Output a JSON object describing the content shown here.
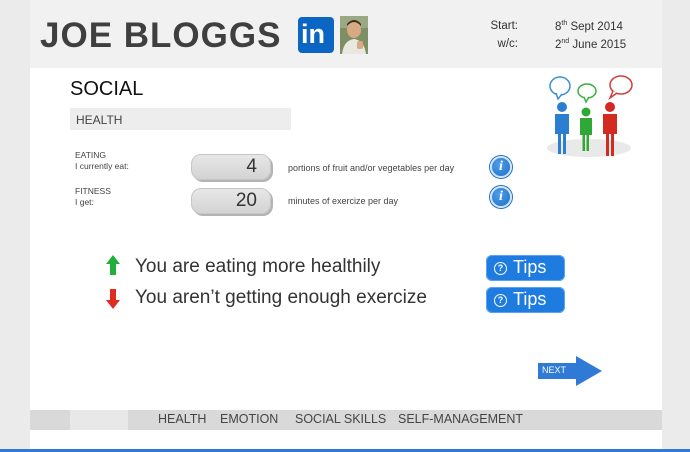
{
  "header": {
    "name": "JOE BLOGGS",
    "linkedin_label": "in",
    "start_label": "Start:",
    "start_day": "8",
    "start_day_suffix": "th",
    "start_rest": " Sept 2014",
    "wc_label": "w/c:",
    "wc_day": "2",
    "wc_day_suffix": "nd",
    "wc_rest": " June 2015"
  },
  "section": {
    "title": "SOCIAL",
    "subheading": "HEALTH"
  },
  "rows": [
    {
      "label_top": "EATING",
      "label_bottom": "I currently eat:",
      "value": "4",
      "note": "portions of fruit and/or vegetables per day"
    },
    {
      "label_top": "FITNESS",
      "label_bottom": "I get:",
      "value": "20",
      "note": "minutes of exercize per day"
    }
  ],
  "info_glyph": "i",
  "feedback": [
    {
      "text": "You are eating more healthily",
      "direction": "up",
      "color": "#22b03a",
      "tips_label": "Tips"
    },
    {
      "text": "You aren’t getting enough exercize",
      "direction": "down",
      "color": "#e02b20",
      "tips_label": "Tips"
    }
  ],
  "tips_glyph": "?",
  "next_label": "NEXT",
  "nav": {
    "tabs": [
      "HEALTH",
      "EMOTION",
      "SOCIAL SKILLS",
      "SELF-MANAGEMENT"
    ]
  },
  "colors": {
    "accent": "#1e7be0",
    "linkedin": "#0a66c2",
    "header_bg": "#f1f1f1",
    "nav_bg": "#d9d9d9"
  },
  "icons": [
    "linkedin-logo-icon",
    "profile-photo",
    "people-speech-bubbles-illustration",
    "info-icon",
    "arrow-up-icon",
    "arrow-down-icon",
    "question-icon",
    "next-arrow-icon"
  ]
}
